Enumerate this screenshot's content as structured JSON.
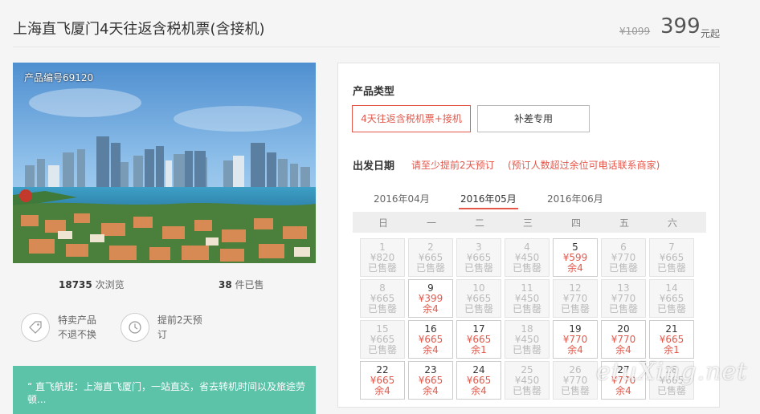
{
  "header": {
    "title": "上海直飞厦门4天往返含税机票(含接机)",
    "price_old": "¥1099",
    "price_now": "399",
    "price_unit": "元起"
  },
  "photo": {
    "product_no": "产品编号69120"
  },
  "stats": {
    "views_num": "18735",
    "views_label": "次浏览",
    "sold_num": "38",
    "sold_label": "件已售"
  },
  "features": [
    {
      "icon": "tag-icon",
      "line1": "特卖产品",
      "line2": "不退不换"
    },
    {
      "icon": "clock-icon",
      "line1": "提前2天预",
      "line2": "订"
    }
  ],
  "info": {
    "text": "“ 直飞航班：上海直飞厦门，一站直达，省去转机时间以及旅途劳顿..."
  },
  "booking": {
    "type_label": "产品类型",
    "options": [
      "4天往返含税机票+接机",
      "补差专用"
    ],
    "date_label": "出发日期",
    "note1": "请至少提前2天预订",
    "note2": "(预订人数超过余位可电话联系商家)",
    "months": [
      "2016年04月",
      "2016年05月",
      "2016年06月"
    ],
    "weekdays": [
      "日",
      "一",
      "二",
      "三",
      "四",
      "五",
      "六"
    ]
  },
  "calendar": [
    {
      "day": "1",
      "price": "¥820",
      "status": "已售罄",
      "open": false
    },
    {
      "day": "2",
      "price": "¥665",
      "status": "已售罄",
      "open": false
    },
    {
      "day": "3",
      "price": "¥665",
      "status": "已售罄",
      "open": false
    },
    {
      "day": "4",
      "price": "¥450",
      "status": "已售罄",
      "open": false
    },
    {
      "day": "5",
      "price": "¥599",
      "status": "余4",
      "open": true
    },
    {
      "day": "6",
      "price": "¥770",
      "status": "已售罄",
      "open": false
    },
    {
      "day": "7",
      "price": "¥665",
      "status": "已售罄",
      "open": false
    },
    {
      "day": "8",
      "price": "¥665",
      "status": "已售罄",
      "open": false
    },
    {
      "day": "9",
      "price": "¥399",
      "status": "余4",
      "open": true
    },
    {
      "day": "10",
      "price": "¥665",
      "status": "已售罄",
      "open": false
    },
    {
      "day": "11",
      "price": "¥450",
      "status": "已售罄",
      "open": false
    },
    {
      "day": "12",
      "price": "¥770",
      "status": "已售罄",
      "open": false
    },
    {
      "day": "13",
      "price": "¥770",
      "status": "已售罄",
      "open": false
    },
    {
      "day": "14",
      "price": "¥665",
      "status": "已售罄",
      "open": false
    },
    {
      "day": "15",
      "price": "¥665",
      "status": "已售罄",
      "open": false
    },
    {
      "day": "16",
      "price": "¥665",
      "status": "余4",
      "open": true
    },
    {
      "day": "17",
      "price": "¥665",
      "status": "余1",
      "open": true
    },
    {
      "day": "18",
      "price": "¥450",
      "status": "已售罄",
      "open": false
    },
    {
      "day": "19",
      "price": "¥770",
      "status": "余4",
      "open": true
    },
    {
      "day": "20",
      "price": "¥770",
      "status": "余4",
      "open": true
    },
    {
      "day": "21",
      "price": "¥665",
      "status": "余1",
      "open": true
    },
    {
      "day": "22",
      "price": "¥665",
      "status": "余4",
      "open": true
    },
    {
      "day": "23",
      "price": "¥665",
      "status": "余4",
      "open": true
    },
    {
      "day": "24",
      "price": "¥665",
      "status": "余4",
      "open": true
    },
    {
      "day": "25",
      "price": "¥450",
      "status": "已售罄",
      "open": false
    },
    {
      "day": "26",
      "price": "¥770",
      "status": "已售罄",
      "open": false
    },
    {
      "day": "27",
      "price": "¥770",
      "status": "余4",
      "open": true
    },
    {
      "day": "28",
      "price": "¥665",
      "status": "已售罄",
      "open": false
    }
  ],
  "watermark": "etuXing.net",
  "colors": {
    "accent": "#e4584b",
    "info_bg": "#5cc3a9"
  }
}
